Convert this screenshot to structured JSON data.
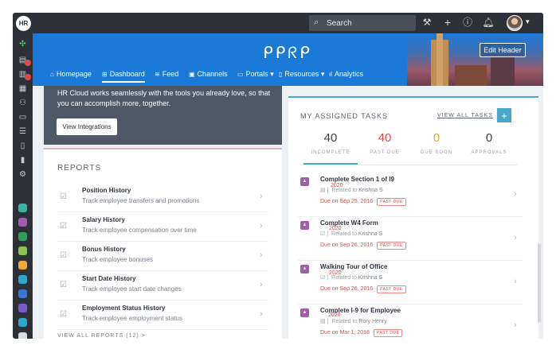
{
  "topbar": {
    "logo": "HR",
    "search_placeholder": "Search"
  },
  "header": {
    "brand": "ᑭᑭᖇᑭ",
    "edit_header_label": "Edit Header",
    "nav": [
      {
        "icon": "home-icon",
        "glyph": "⌂",
        "label": "Homepage"
      },
      {
        "icon": "grid-icon",
        "glyph": "⊞",
        "label": "Dashboard"
      },
      {
        "icon": "feed-icon",
        "glyph": "≋",
        "label": "Feed"
      },
      {
        "icon": "channels-icon",
        "glyph": "▣",
        "label": "Channels"
      },
      {
        "icon": "portals-icon",
        "glyph": "▭",
        "label": "Portals ▾"
      },
      {
        "icon": "resources-icon",
        "glyph": "▯",
        "label": "Resources ▾"
      },
      {
        "icon": "analytics-icon",
        "glyph": "ıl",
        "label": "Analytics"
      }
    ]
  },
  "integrations": {
    "text": "HR Cloud works seamlessly with the tools you already love, so that you can accomplish more, together.",
    "button_label": "View Integrations"
  },
  "reports": {
    "title": "REPORTS",
    "items": [
      {
        "title": "Position History",
        "description": "Track employee transfers and promotions"
      },
      {
        "title": "Salary History",
        "description": "Track employee compensation over time"
      },
      {
        "title": "Bonus History",
        "description": "Track employee bonuses"
      },
      {
        "title": "Start Date History",
        "description": "Track employee start date changes"
      },
      {
        "title": "Employment Status History",
        "description": "Track employee employment status"
      }
    ],
    "view_all_label": "VIEW ALL REPORTS (12)  >"
  },
  "tasks": {
    "title": "MY ASSIGNED TASKS",
    "view_all_label": "VIEW ALL TASKS",
    "add_label": "+",
    "stats": [
      {
        "value": "40",
        "label": "INCOMPLETE",
        "color": "#3a4049"
      },
      {
        "value": "40",
        "label": "PAST DUE",
        "color": "#e04a4a"
      },
      {
        "value": "0",
        "label": "DUE SOON",
        "color": "#f0a830"
      },
      {
        "value": "0",
        "label": "APPROVALS",
        "color": "#3a4049"
      }
    ],
    "items": [
      {
        "title": "Complete Section 1 of I9",
        "related_prefix": "Related to",
        "related_name": "Krishna S",
        "due": "Due on Sep 25, 2016",
        "badge": "PAST DUE"
      },
      {
        "title": "Complete W4 Form",
        "related_prefix": "Related to",
        "related_name": "Krishna S",
        "due": "Due on Sep 26, 2016",
        "badge": "PAST DUE"
      },
      {
        "title": "Walking Tour of Office",
        "related_prefix": "Related to",
        "related_name": "Krishna S",
        "due": "Due on Sep 26, 2016",
        "badge": "PAST DUE"
      },
      {
        "title": "Complete I-9 for Employee",
        "related_prefix": "Related to",
        "related_name": "Rory Henry",
        "due": "Due on Mar 1, 2018",
        "badge": "PAST DUE"
      }
    ],
    "year_marks": [
      "2020",
      "2020",
      "2020",
      "2020",
      "2020"
    ]
  },
  "colors": {
    "brand_blue": "#1b7ad8",
    "accent_teal": "#4aa7c9",
    "danger": "#e04a4a",
    "warning": "#f0a830",
    "dark_chrome": "#2d3137"
  }
}
